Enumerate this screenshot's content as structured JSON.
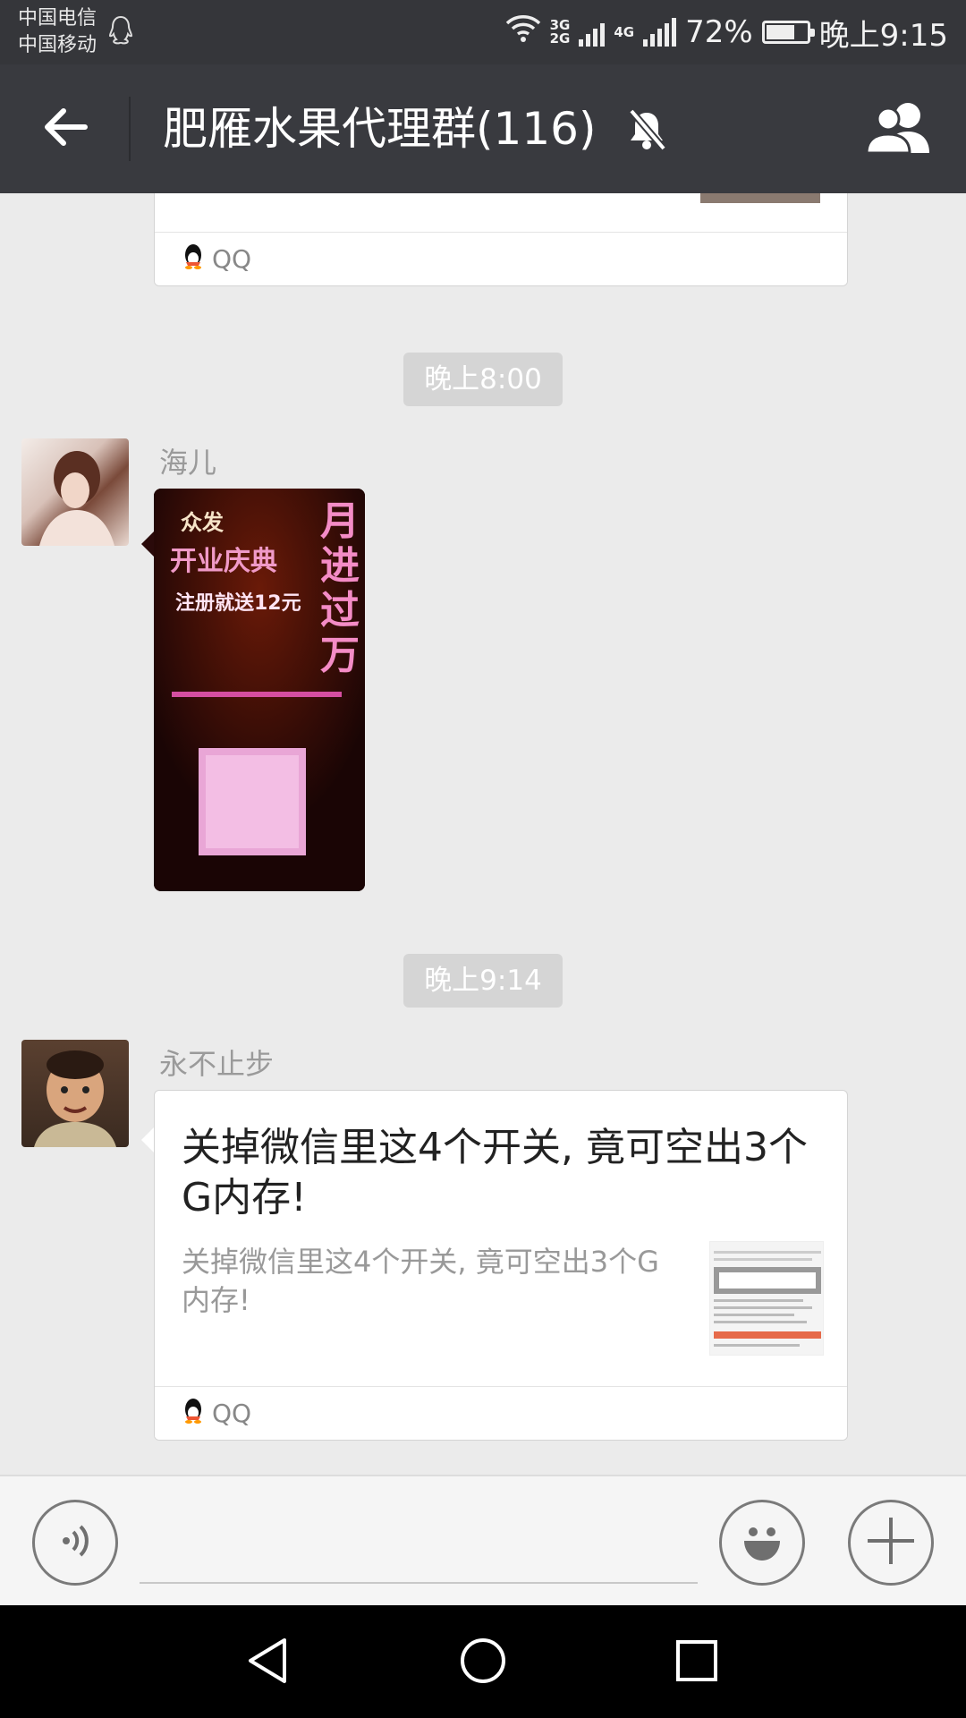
{
  "status_bar": {
    "carrier_1": "中国电信",
    "carrier_2": "中国移动",
    "net_3g_top": "3G",
    "net_3g_bottom": "2G",
    "net_4g": "4G",
    "battery": "72%",
    "battery_level": 0.72,
    "time": "晚上9:15"
  },
  "header": {
    "title": "肥雁水果代理群(116)",
    "icons": [
      "back-arrow-icon",
      "muted-bell-icon",
      "group-members-icon"
    ]
  },
  "messages": [
    {
      "type": "link_card_partial",
      "source": "QQ"
    },
    {
      "type": "timestamp",
      "text": "晚上8:00"
    },
    {
      "type": "image",
      "sender": "海儿",
      "image_text": {
        "top": "众发",
        "title": "开业庆典",
        "side": "月进过万",
        "line": "注册就送12元"
      }
    },
    {
      "type": "timestamp",
      "text": "晚上9:14"
    },
    {
      "type": "link_card",
      "sender": "永不止步",
      "title": "关掉微信里这4个开关, 竟可空出3个G内存!",
      "description": "关掉微信里这4个开关, 竟可空出3个G内存!",
      "source": "QQ"
    }
  ],
  "input_bar": {
    "placeholder": "",
    "icons": [
      "voice-icon",
      "emoji-icon",
      "plus-icon"
    ]
  },
  "nav_bar": {
    "icons": [
      "nav-back-icon",
      "nav-home-icon",
      "nav-recents-icon"
    ]
  },
  "colors": {
    "header_bg": "#393a3f",
    "status_bg": "#35363a",
    "chat_bg": "#ebebeb",
    "timestamp_bg": "#d5d5d5"
  }
}
